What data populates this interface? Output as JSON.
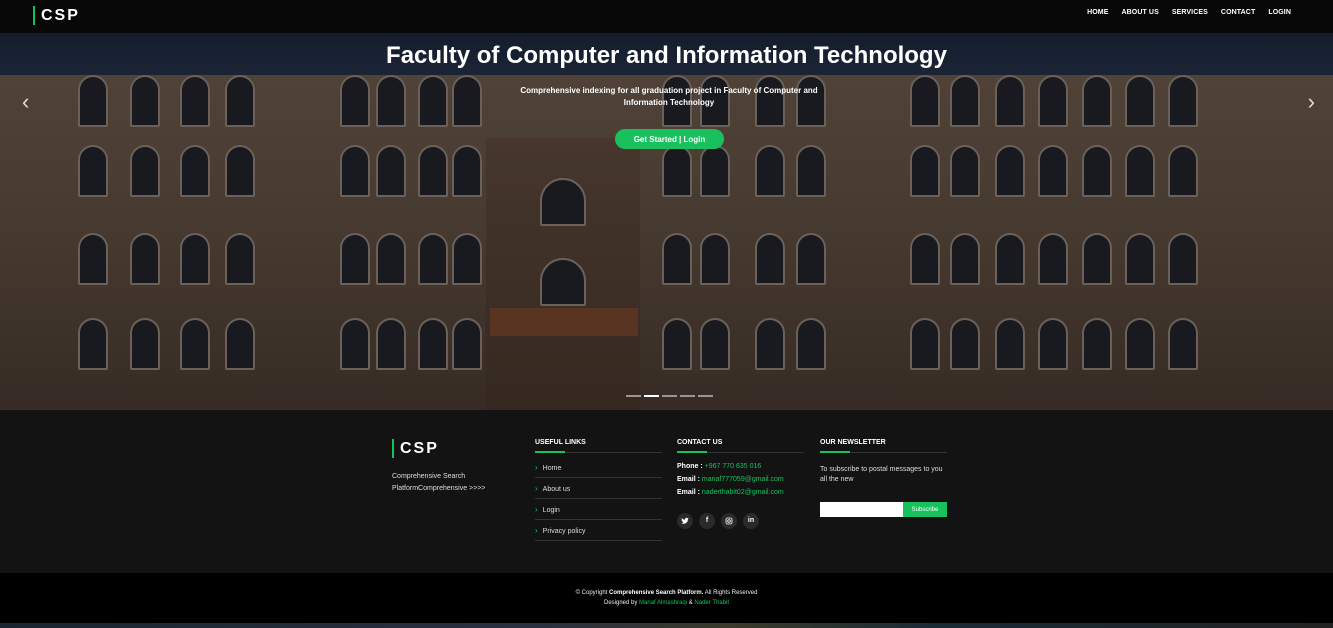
{
  "header": {
    "logo": "CSP",
    "nav": [
      "HOME",
      "ABOUT US",
      "SERVICES",
      "CONTACT",
      "LOGIN"
    ]
  },
  "hero": {
    "title": "Faculty of Computer and Information Technology",
    "subtitle": "Comprehensive indexing for all graduation project in Faculty of Computer and Information Technology",
    "button": "Get Started | Login",
    "prev_icon": "chevron-left-icon",
    "next_icon": "chevron-right-icon",
    "slides": 5,
    "active_slide": 2
  },
  "footer": {
    "logo": "CSP",
    "description": "Comprehensive Search PlatformComprehensive >>>>",
    "useful_links": {
      "heading": "USEFUL LINKS",
      "items": [
        "Home",
        "About us",
        "Login",
        "Privacy policy"
      ]
    },
    "contact": {
      "heading": "CONTACT US",
      "phone_label": "Phone :",
      "phone": "+967 770 635 016",
      "email_label": "Email :",
      "email1": "manaf777059@gmail.com",
      "email2": "naderthabit02@gmail.com",
      "socials": [
        "twitter-icon",
        "facebook-icon",
        "instagram-icon",
        "linkedin-icon"
      ]
    },
    "newsletter": {
      "heading": "OUR NEWSLETTER",
      "text": "To subscribe to postal messages to you all the new",
      "button": "Subscribe"
    }
  },
  "bottom": {
    "copyright_prefix": "© Copyright",
    "site_name": "Comprehensive Search Platform.",
    "rights": "All Rights Reserved",
    "designed_by": "Designed by",
    "author1": "Manaf Almashraqi",
    "amp": "&",
    "author2": "Nader Thabit"
  },
  "colors": {
    "accent": "#19c15e",
    "header": "#080808",
    "footer": "#131313"
  }
}
